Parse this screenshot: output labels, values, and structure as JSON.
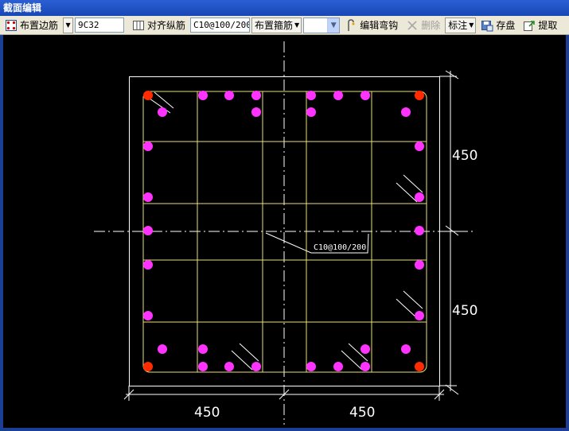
{
  "window": {
    "title": "截面编辑"
  },
  "toolbar": {
    "place_edge_bars": "布置边筋",
    "edge_bar_spec": "9C32",
    "align_long_bars": "对齐纵筋",
    "stirrup_spec": "C10@100/200",
    "place_stirrups": "布置箍筋",
    "combo_value": "",
    "edit_hook": "编辑弯钩",
    "delete": "删除",
    "annotate": "标注",
    "save": "存盘",
    "extract": "提取"
  },
  "drawing": {
    "stirrup_label": "C10@100/200",
    "dim_right_top": "450",
    "dim_right_bottom": "450",
    "dim_bottom_left": "450",
    "dim_bottom_right": "450",
    "colors": {
      "background": "#000000",
      "outline": "#ffffff",
      "stirrup": "#e8e07a",
      "rebar": "#ff33ff",
      "corner_rebar": "#ff2a00",
      "centerline": "#ffffff"
    }
  }
}
